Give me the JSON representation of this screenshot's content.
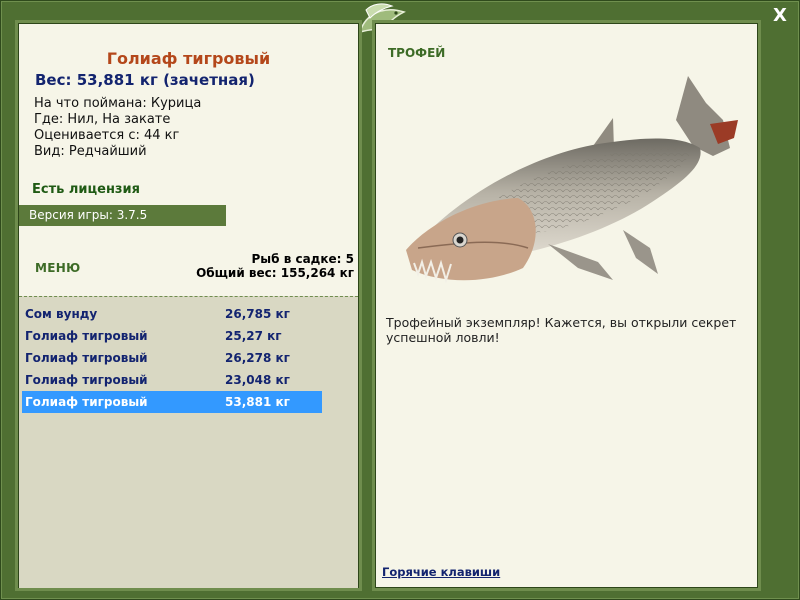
{
  "window": {
    "close_label": "X"
  },
  "left": {
    "fish_name": "Голиаф тигровый",
    "weight": "Вес: 53,881 кг (зачетная)",
    "details": [
      "На что поймана: Курица",
      "Где: Нил, На закате",
      "Оценивается с: 44 кг",
      "Вид: Редчайший"
    ],
    "license": "Есть лицензия",
    "version": "Версия игры: 3.7.5",
    "menu": "МЕНЮ",
    "keepnet_count": "Рыб в садке: 5",
    "keepnet_total": "Общий вес: 155,264 кг",
    "catch_list": [
      {
        "name": "Сом вунду",
        "weight": "26,785 кг",
        "selected": false
      },
      {
        "name": "Голиаф тигровый",
        "weight": "25,27 кг",
        "selected": false
      },
      {
        "name": "Голиаф тигровый",
        "weight": "26,278 кг",
        "selected": false
      },
      {
        "name": "Голиаф тигровый",
        "weight": "23,048 кг",
        "selected": false
      },
      {
        "name": "Голиаф тигровый",
        "weight": "53,881 кг",
        "selected": true
      }
    ]
  },
  "right": {
    "trophy_label": "ТРОФЕЙ",
    "description": "Трофейный экземпляр! Кажется, вы открыли секрет успешной ловли!",
    "hotkeys": "Горячие клавиши"
  },
  "colors": {
    "frame": "#4f6f32",
    "panel": "#f6f5e8",
    "list_bg": "#d9d8c3",
    "selected_row": "#3399ff",
    "title": "#b4471a",
    "link": "#13246f"
  },
  "icons": {
    "logo": "fish-logo-icon",
    "close": "close-icon",
    "trophy_fish": "tiger-goliath-fish-image"
  }
}
